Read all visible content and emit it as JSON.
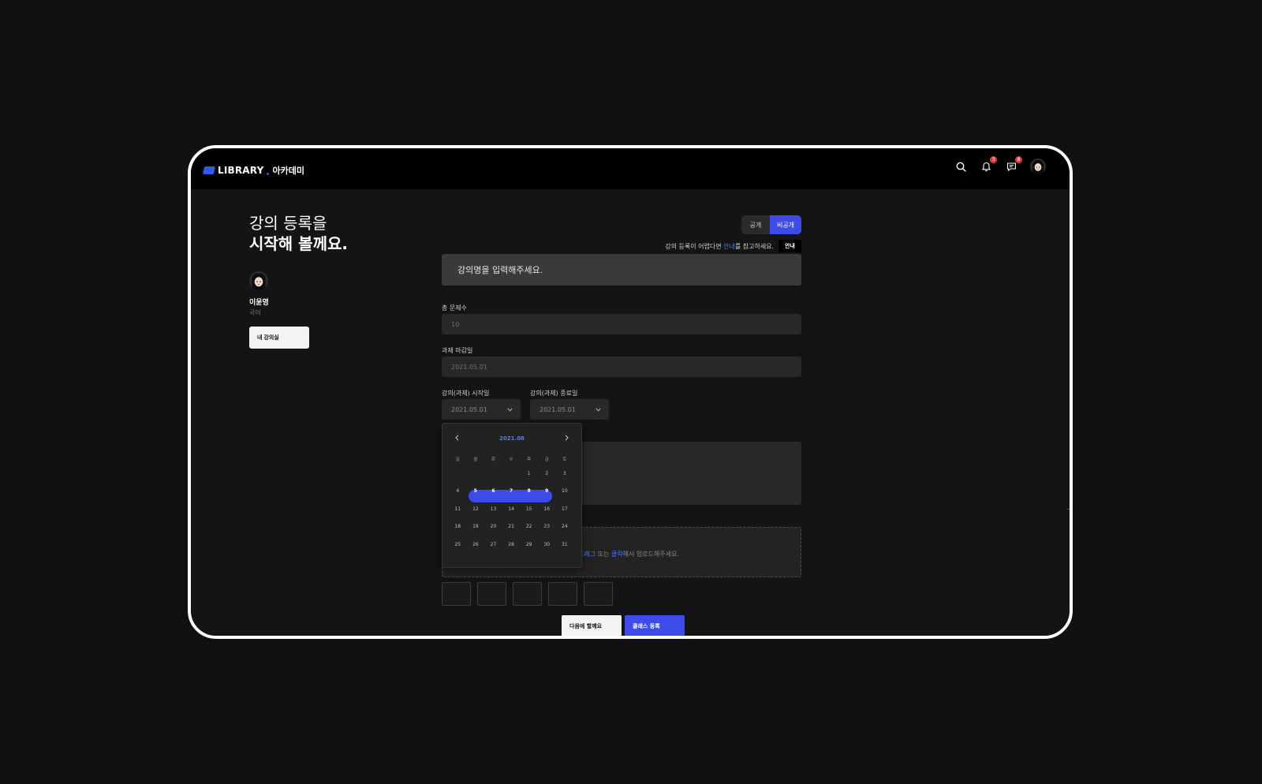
{
  "header": {
    "logo_text": "LIBRARY",
    "logo_sub": "아카데미",
    "notifications_count": "3",
    "messages_count": "8"
  },
  "sidebar": {
    "hero_line1": "강의 등록을",
    "hero_line2": "시작해 볼께요.",
    "user_name": "이윤영",
    "user_subject": "국어",
    "my_class_label": "내 강의실"
  },
  "visibility": {
    "public_label": "공개",
    "private_label": "비공개",
    "selected": "비공개"
  },
  "help": {
    "text_before": "강의 등록이 어렵다면",
    "link": "안내",
    "text_after": "를 참고하세요.",
    "button": "안내"
  },
  "form": {
    "title_placeholder": "강의명을 입력해주세요.",
    "question_count_label": "총 문제수",
    "question_count_value": "10",
    "deadline_label": "과제 마감일",
    "deadline_value": "2021.05.01",
    "start_label": "강의(과제) 시작일",
    "start_value": "2021.05.01",
    "end_label": "강의(과제) 종료일",
    "end_value": "2021.05.01"
  },
  "upload": {
    "text_drag": "드래그",
    "text_or": " 또는 ",
    "text_click": "클릭",
    "text_rest": "해서 업로드해주세요."
  },
  "calendar": {
    "month": "2021.08",
    "weekdays": [
      "일",
      "월",
      "화",
      "수",
      "목",
      "금",
      "토"
    ],
    "weeks": [
      [
        "",
        "",
        "",
        "",
        "1",
        "2",
        "3"
      ],
      [
        "4",
        "5",
        "6",
        "7",
        "8",
        "9",
        "10"
      ],
      [
        "11",
        "12",
        "13",
        "14",
        "15",
        "16",
        "17"
      ],
      [
        "18",
        "19",
        "20",
        "21",
        "22",
        "23",
        "24"
      ],
      [
        "25",
        "26",
        "27",
        "28",
        "29",
        "30",
        "31"
      ]
    ],
    "selected_range": [
      "5",
      "6",
      "7",
      "8",
      "9"
    ]
  },
  "actions": {
    "later_label": "다음에 할께요",
    "submit_label": "클래스 등록"
  },
  "colors": {
    "accent": "#3d4bea",
    "link": "#4a7bff",
    "badge": "#e53935",
    "background": "#141414"
  }
}
